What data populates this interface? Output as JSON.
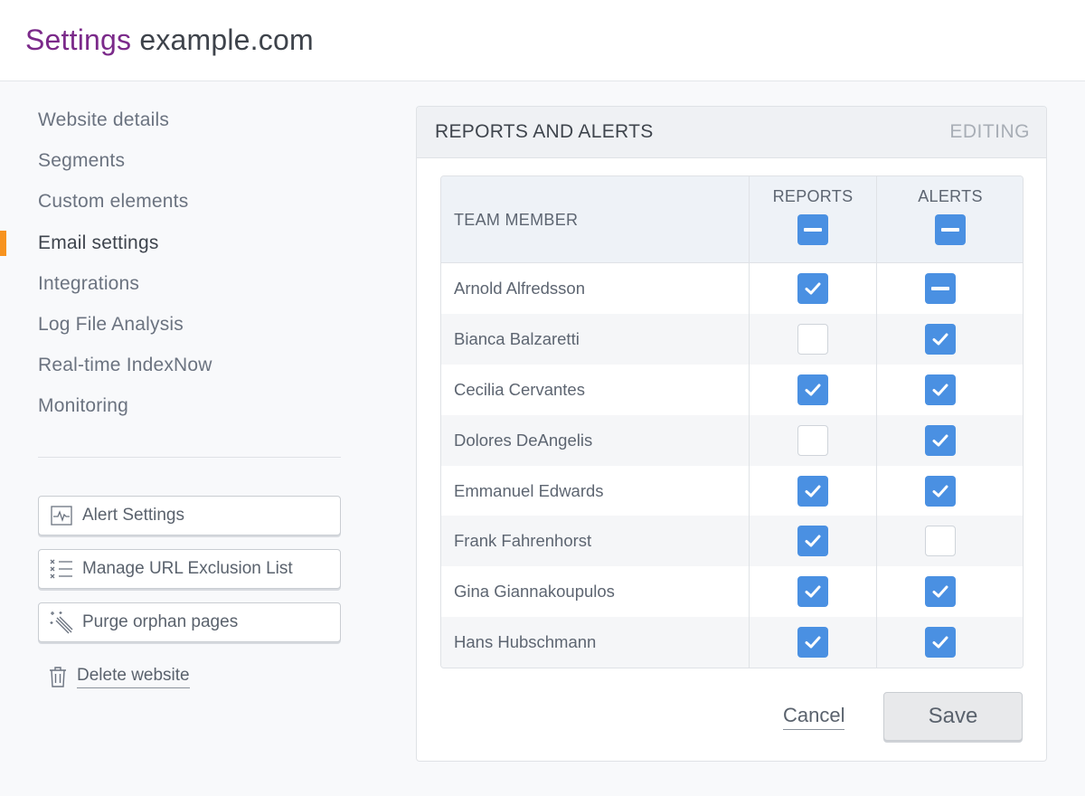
{
  "header": {
    "title_word": "Settings",
    "site": "example.com",
    "title_color": "#7b2a8a"
  },
  "sidebar": {
    "active_index": 3,
    "accent_color": "#f7931e",
    "items": [
      {
        "label": "Website details"
      },
      {
        "label": "Segments"
      },
      {
        "label": "Custom elements"
      },
      {
        "label": "Email settings"
      },
      {
        "label": "Integrations"
      },
      {
        "label": "Log File Analysis"
      },
      {
        "label": "Real-time IndexNow"
      },
      {
        "label": "Monitoring"
      }
    ],
    "actions": [
      {
        "label": "Alert Settings",
        "icon": "pulse-chart-icon"
      },
      {
        "label": "Manage URL Exclusion List",
        "icon": "exclusion-list-icon"
      },
      {
        "label": "Purge orphan pages",
        "icon": "magic-wand-icon"
      }
    ],
    "delete": {
      "label": "Delete website",
      "icon": "trash-icon"
    }
  },
  "panel": {
    "title": "REPORTS AND ALERTS",
    "status": "EDITING",
    "columns": {
      "member": "TEAM MEMBER",
      "reports": "REPORTS",
      "alerts": "ALERTS"
    },
    "header_states": {
      "reports": "partial",
      "alerts": "partial"
    },
    "checkbox_color": "#4a90e2",
    "rows": [
      {
        "name": "Arnold Alfredsson",
        "reports": "checked",
        "alerts": "partial"
      },
      {
        "name": "Bianca Balzaretti",
        "reports": "unchecked",
        "alerts": "checked"
      },
      {
        "name": "Cecilia Cervantes",
        "reports": "checked",
        "alerts": "checked"
      },
      {
        "name": "Dolores DeAngelis",
        "reports": "unchecked",
        "alerts": "checked"
      },
      {
        "name": "Emmanuel Edwards",
        "reports": "checked",
        "alerts": "checked"
      },
      {
        "name": "Frank Fahrenhorst",
        "reports": "checked",
        "alerts": "unchecked"
      },
      {
        "name": "Gina Giannakoupulos",
        "reports": "checked",
        "alerts": "checked"
      },
      {
        "name": "Hans Hubschmann",
        "reports": "checked",
        "alerts": "checked"
      }
    ],
    "cancel_label": "Cancel",
    "save_label": "Save"
  }
}
